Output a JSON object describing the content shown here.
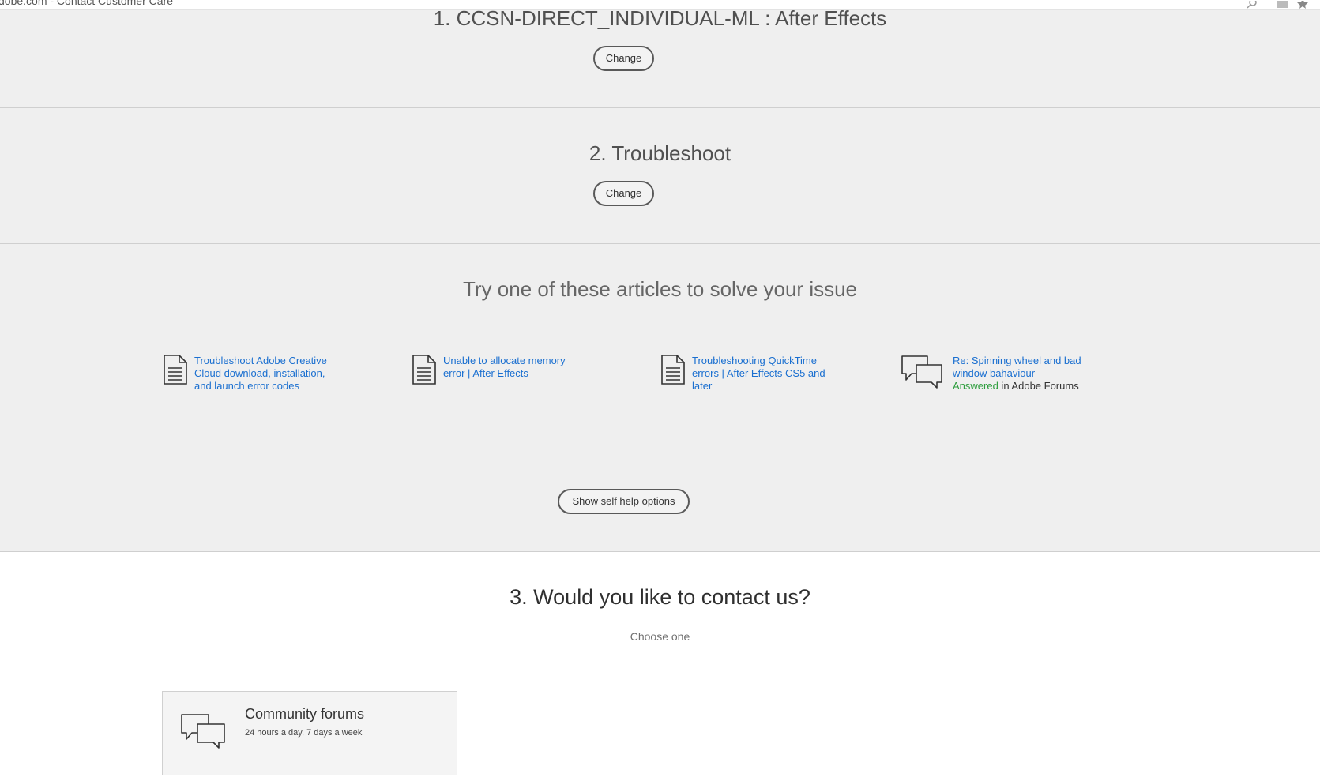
{
  "browser": {
    "tab_text": "dobe.com - Contact Customer Care"
  },
  "step1": {
    "title": "1. CCSN-DIRECT_INDIVIDUAL-ML : After Effects",
    "change_label": "Change"
  },
  "step2": {
    "title": "2. Troubleshoot",
    "change_label": "Change"
  },
  "articles": {
    "heading": "Try one of these articles to solve your issue",
    "items": [
      {
        "icon": "document-icon",
        "title": "Troubleshoot Adobe Creative Cloud download, installation, and launch error codes"
      },
      {
        "icon": "document-icon",
        "title": "Unable to allocate memory error | After Effects"
      },
      {
        "icon": "document-icon",
        "title": "Troubleshooting QuickTime errors | After Effects CS5 and later"
      },
      {
        "icon": "chat-bubbles-icon",
        "title": "Re: Spinning wheel and bad window bahaviour",
        "status": "Answered",
        "source": " in Adobe Forums"
      }
    ],
    "show_self_help_label": "Show self help options"
  },
  "contact": {
    "title": "3. Would you like to contact us?",
    "subtitle": "Choose one",
    "options": [
      {
        "icon": "chat-bubbles-icon",
        "title": "Community forums",
        "subtitle": "24 hours a day, 7 days a week"
      }
    ]
  },
  "colors": {
    "band_bg": "#efefef",
    "link": "#1a6fd0",
    "answered": "#2f9e3f"
  }
}
